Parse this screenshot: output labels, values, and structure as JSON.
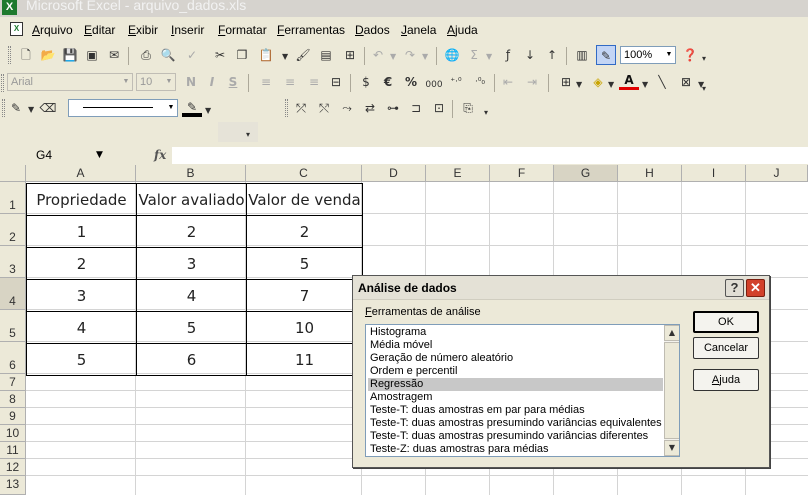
{
  "window": {
    "title": "Microsoft Excel - arquivo_dados.xls",
    "app_icon": "X"
  },
  "menu": [
    "Arquivo",
    "Editar",
    "Exibir",
    "Inserir",
    "Formatar",
    "Ferramentas",
    "Dados",
    "Janela",
    "Ajuda"
  ],
  "toolbar": {
    "zoom": "100%",
    "font_name": "Arial",
    "font_size": "10",
    "bold": "N",
    "italic": "I",
    "underline": "S",
    "sum_icon": "Σ",
    "currency": "€",
    "percent": "%",
    "thousands": "000",
    "font_color_letter": "A"
  },
  "formula_bar": {
    "name_box": "G4",
    "fx": "fx",
    "value": ""
  },
  "sheet": {
    "columns": [
      "A",
      "B",
      "C",
      "D",
      "E",
      "F",
      "G",
      "H",
      "I",
      "J"
    ],
    "rows": [
      "1",
      "2",
      "3",
      "4",
      "5",
      "6",
      "7",
      "8",
      "9",
      "10",
      "11",
      "12",
      "13"
    ],
    "selected_cell": "G4",
    "table": {
      "headers": [
        "Propriedade",
        "Valor avaliado",
        "Valor de venda"
      ],
      "rows": [
        [
          "1",
          "2",
          "2"
        ],
        [
          "2",
          "3",
          "5"
        ],
        [
          "3",
          "4",
          "7"
        ],
        [
          "4",
          "5",
          "10"
        ],
        [
          "5",
          "6",
          "11"
        ]
      ]
    }
  },
  "dialog": {
    "title": "Análise de dados",
    "help_icon": "?",
    "close_icon": "✕",
    "list_label": "Ferramentas de análise",
    "items": [
      "Histograma",
      "Média móvel",
      "Geração de número aleatório",
      "Ordem e percentil",
      "Regressão",
      "Amostragem",
      "Teste-T: duas amostras em par para médias",
      "Teste-T: duas amostras presumindo variâncias equivalentes",
      "Teste-T: duas amostras presumindo variâncias diferentes",
      "Teste-Z: duas amostras para médias"
    ],
    "selected_item": "Regressão",
    "buttons": {
      "ok": "OK",
      "cancel": "Cancelar",
      "help": "Ajuda"
    }
  }
}
